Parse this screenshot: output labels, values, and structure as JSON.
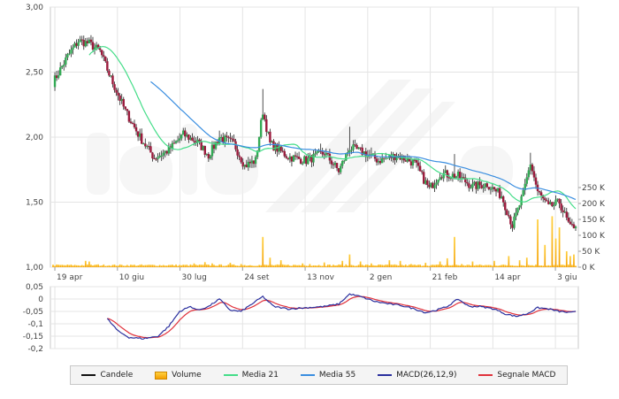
{
  "chart_data": {
    "type": "candlestick",
    "colors": {
      "up_candle": "#33aa55",
      "down_candle": "#9b1a3c",
      "volume": "#f5a000",
      "ma21": "#44dd88",
      "ma55": "#3a8ee0",
      "macd": "#2a2f9e",
      "signal": "#e0323c",
      "grid": "#e4e4e4"
    },
    "x_ticks": [
      "19 apr",
      "10 giu",
      "30 lug",
      "24 set",
      "13 nov",
      "2 gen",
      "21 feb",
      "14 apr",
      "3 giu"
    ],
    "price_axis": {
      "ticks": [
        "3,00",
        "2,50",
        "2,00",
        "1,50",
        "1,00"
      ],
      "ylim": [
        1.0,
        3.0
      ]
    },
    "volume_axis": {
      "ticks": [
        "250 K",
        "200 K",
        "150 K",
        "100 K",
        "50 K",
        "0 K"
      ],
      "ylim": [
        0,
        250000
      ]
    },
    "macd_axis": {
      "ticks": [
        "0,05",
        "0",
        "-0,05",
        "-0,1",
        "-0,15",
        "-0,2"
      ],
      "ylim": [
        -0.2,
        0.05
      ]
    },
    "n_periods": 290,
    "anchors": [
      [
        0,
        2.42
      ],
      [
        8,
        2.62
      ],
      [
        14,
        2.74
      ],
      [
        20,
        2.72
      ],
      [
        26,
        2.66
      ],
      [
        32,
        2.45
      ],
      [
        40,
        2.2
      ],
      [
        48,
        2.0
      ],
      [
        56,
        1.84
      ],
      [
        64,
        1.9
      ],
      [
        72,
        2.02
      ],
      [
        80,
        1.96
      ],
      [
        86,
        1.86
      ],
      [
        92,
        2.0
      ],
      [
        100,
        1.95
      ],
      [
        106,
        1.78
      ],
      [
        112,
        1.82
      ],
      [
        116,
        2.2
      ],
      [
        120,
        1.95
      ],
      [
        130,
        1.85
      ],
      [
        140,
        1.82
      ],
      [
        150,
        1.88
      ],
      [
        158,
        1.74
      ],
      [
        164,
        1.92
      ],
      [
        172,
        1.88
      ],
      [
        180,
        1.82
      ],
      [
        190,
        1.86
      ],
      [
        200,
        1.8
      ],
      [
        208,
        1.6
      ],
      [
        214,
        1.72
      ],
      [
        224,
        1.7
      ],
      [
        232,
        1.62
      ],
      [
        240,
        1.64
      ],
      [
        248,
        1.55
      ],
      [
        254,
        1.32
      ],
      [
        260,
        1.56
      ],
      [
        264,
        1.8
      ],
      [
        268,
        1.58
      ],
      [
        274,
        1.46
      ],
      [
        280,
        1.5
      ],
      [
        286,
        1.3
      ],
      [
        289,
        1.33
      ]
    ],
    "spikes": [
      [
        116,
        2.37
      ],
      [
        92,
        2.05
      ],
      [
        164,
        2.08
      ],
      [
        222,
        1.87
      ],
      [
        264,
        1.88
      ],
      [
        148,
        1.95
      ],
      [
        176,
        1.92
      ]
    ],
    "volume_baseline": 4000,
    "volume_spikes": [
      [
        18,
        20000
      ],
      [
        20,
        18000
      ],
      [
        25,
        9000
      ],
      [
        50,
        6000
      ],
      [
        78,
        12000
      ],
      [
        84,
        16000
      ],
      [
        88,
        12000
      ],
      [
        98,
        14000
      ],
      [
        104,
        10000
      ],
      [
        116,
        95000
      ],
      [
        120,
        30000
      ],
      [
        126,
        22000
      ],
      [
        138,
        12000
      ],
      [
        142,
        10000
      ],
      [
        150,
        15000
      ],
      [
        160,
        20000
      ],
      [
        164,
        40000
      ],
      [
        170,
        18000
      ],
      [
        176,
        12000
      ],
      [
        186,
        22000
      ],
      [
        192,
        20000
      ],
      [
        198,
        10000
      ],
      [
        206,
        14000
      ],
      [
        214,
        18000
      ],
      [
        218,
        28000
      ],
      [
        222,
        95000
      ],
      [
        226,
        10000
      ],
      [
        232,
        18000
      ],
      [
        244,
        20000
      ],
      [
        252,
        35000
      ],
      [
        258,
        22000
      ],
      [
        262,
        30000
      ],
      [
        268,
        150000
      ],
      [
        272,
        70000
      ],
      [
        276,
        160000
      ],
      [
        278,
        90000
      ],
      [
        280,
        125000
      ],
      [
        284,
        50000
      ],
      [
        286,
        35000
      ],
      [
        288,
        40000
      ]
    ],
    "macd_start": 30,
    "macd_anchors": [
      [
        30,
        -0.08
      ],
      [
        36,
        -0.13
      ],
      [
        42,
        -0.155
      ],
      [
        50,
        -0.16
      ],
      [
        58,
        -0.15
      ],
      [
        64,
        -0.11
      ],
      [
        70,
        -0.05
      ],
      [
        76,
        -0.03
      ],
      [
        80,
        -0.045
      ],
      [
        86,
        -0.03
      ],
      [
        92,
        0.0
      ],
      [
        98,
        -0.045
      ],
      [
        104,
        -0.05
      ],
      [
        110,
        -0.02
      ],
      [
        116,
        0.01
      ],
      [
        122,
        -0.03
      ],
      [
        130,
        -0.04
      ],
      [
        140,
        -0.035
      ],
      [
        150,
        -0.03
      ],
      [
        158,
        -0.02
      ],
      [
        164,
        0.02
      ],
      [
        170,
        0.01
      ],
      [
        178,
        -0.01
      ],
      [
        186,
        -0.02
      ],
      [
        192,
        -0.025
      ],
      [
        200,
        -0.04
      ],
      [
        206,
        -0.055
      ],
      [
        212,
        -0.045
      ],
      [
        218,
        -0.03
      ],
      [
        224,
        0.0
      ],
      [
        230,
        -0.03
      ],
      [
        236,
        -0.03
      ],
      [
        244,
        -0.04
      ],
      [
        250,
        -0.06
      ],
      [
        256,
        -0.07
      ],
      [
        262,
        -0.06
      ],
      [
        268,
        -0.035
      ],
      [
        274,
        -0.04
      ],
      [
        280,
        -0.05
      ],
      [
        286,
        -0.055
      ],
      [
        289,
        -0.052
      ]
    ],
    "legend": [
      {
        "key": "candles",
        "label": "Candele",
        "kind": "line",
        "color": "#111111"
      },
      {
        "key": "volume",
        "label": "Volume",
        "kind": "box",
        "color": "#f5a000"
      },
      {
        "key": "ma21",
        "label": "Media 21",
        "kind": "line",
        "color": "#44dd88"
      },
      {
        "key": "ma55",
        "label": "Media 55",
        "kind": "line",
        "color": "#3a8ee0"
      },
      {
        "key": "macd",
        "label": "MACD(26,12,9)",
        "kind": "line",
        "color": "#2a2f9e"
      },
      {
        "key": "signal",
        "label": "Segnale MACD",
        "kind": "line",
        "color": "#e0323c"
      }
    ]
  }
}
